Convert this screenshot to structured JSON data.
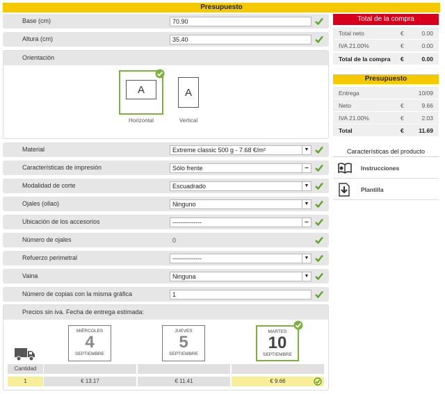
{
  "header": {
    "title": "Presupuesto"
  },
  "form": {
    "base": {
      "label": "Base (cm)",
      "value": "70.90"
    },
    "altura": {
      "label": "Altura (cm)",
      "value": "35.40"
    },
    "orientation": {
      "label": "Orientación",
      "options": [
        {
          "letter": "A",
          "caption": "Horizontal",
          "selected": true
        },
        {
          "letter": "A",
          "caption": "Vertical",
          "selected": false
        }
      ]
    },
    "material": {
      "label": "Material",
      "value": "Extreme classic 500 g - 7.68 €/m²"
    },
    "impresion": {
      "label": "Características de impresión",
      "value": "Sólo frente"
    },
    "corte": {
      "label": "Modalidad de corte",
      "value": "Escuadrado"
    },
    "ojales": {
      "label": "Ojales (ollao)",
      "value": "Ninguno"
    },
    "ubicacion": {
      "label": "Ubicación de los accesorios",
      "value": "--------------"
    },
    "numero_ojales": {
      "label": "Número de ojales",
      "value": "0"
    },
    "refuerzo": {
      "label": "Refuerzo perimetral",
      "value": "--------------"
    },
    "vaina": {
      "label": "Vaina",
      "value": "Ninguna"
    },
    "copias": {
      "label": "Número de copias con la misma gráfica",
      "value": "1"
    }
  },
  "delivery": {
    "title": "Precios sin iva. Fecha de entrega estimada:",
    "quantity_header": "Cantidad",
    "quantity": "1",
    "dates": [
      {
        "weekday": "MIÉRCOLES",
        "day": "4",
        "month": "SEPTIEMBRE",
        "price": "€ 13.17",
        "selected": false
      },
      {
        "weekday": "JUEVES",
        "day": "5",
        "month": "SEPTIEMBRE",
        "price": "€ 11.41",
        "selected": false
      },
      {
        "weekday": "MARTES",
        "day": "10",
        "month": "SEPTIEMBRE",
        "price": "€ 9.66",
        "selected": true
      }
    ]
  },
  "total_compra": {
    "title": "Total de la compra",
    "rows": [
      {
        "label": "Total neto",
        "currency": "€",
        "value": "0.00"
      },
      {
        "label": "IVA 21.00%",
        "currency": "€",
        "value": "0.00"
      },
      {
        "label": "Total de la compra",
        "currency": "€",
        "value": "0.00"
      }
    ]
  },
  "presupuesto": {
    "title": "Presupuesto",
    "entrega_label": "Entrega",
    "entrega_value": "10/09",
    "rows": [
      {
        "label": "Neto",
        "currency": "€",
        "value": "9.66"
      },
      {
        "label": "IVA 21.00%",
        "currency": "€",
        "value": "2.03"
      },
      {
        "label": "Total",
        "currency": "€",
        "value": "11.69"
      }
    ]
  },
  "caracteristicas": {
    "title": "Características del producto",
    "items": [
      {
        "label": "Instrucciones",
        "icon": "book-icon"
      },
      {
        "label": "Plantilla",
        "icon": "download-icon"
      }
    ]
  },
  "colors": {
    "yellow": "#f5c900",
    "red": "#d6001c",
    "green": "#7bb13c",
    "highlight": "#f8ee9a"
  }
}
